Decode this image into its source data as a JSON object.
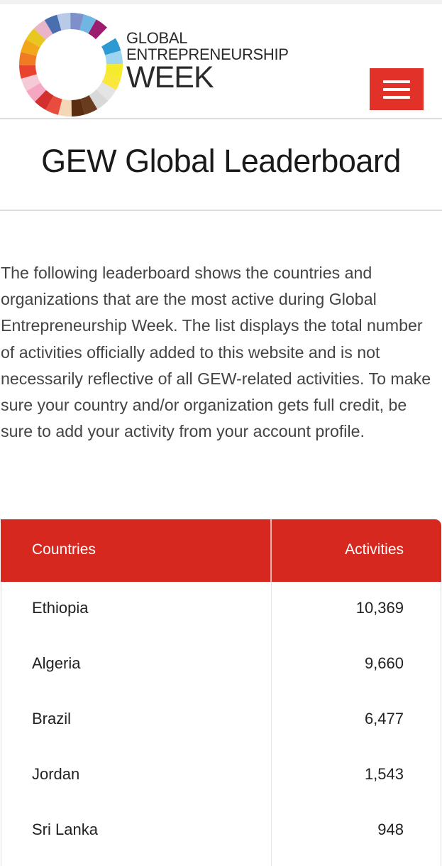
{
  "header": {
    "logo_line1": "GLOBAL",
    "logo_line2": "ENTREPRENEURSHIP",
    "logo_line3": "WEEK",
    "menu_icon": "hamburger-icon",
    "menu_color": "#e23128",
    "logo_ring_colors": [
      "#6fb7e2",
      "#9b1f6e",
      "#ffffff",
      "#2e9ad3",
      "#9ed4ef",
      "#f4ec2a",
      "#f9e83b",
      "#e4e4e4",
      "#d8d8d8",
      "#6b3b1f",
      "#5a2d12",
      "#f5d7b8",
      "#e74c3c",
      "#d32f2f",
      "#f4a6c3",
      "#f6c9d7",
      "#e8432f",
      "#ef7b22",
      "#f2a71b",
      "#e8c71e",
      "#eab5c8",
      "#4a6fb0",
      "#b9c9e8",
      "#7e8fc9"
    ]
  },
  "page": {
    "title": "GEW Global Leaderboard",
    "intro": "The following leaderboard shows the countries and organizations that are the most active during Global Entrepreneurship Week. The list displays the total number of activities officially added to this website and is not necessarily reflective of all GEW-related activities. To make sure your country and/or organization gets full credit, be sure to add your activity from your account profile."
  },
  "leaderboard": {
    "header_color": "#d6281e",
    "columns": {
      "countries": "Countries",
      "activities": "Activities"
    },
    "rows": [
      {
        "country": "Ethiopia",
        "activities": "10,369"
      },
      {
        "country": "Algeria",
        "activities": "9,660"
      },
      {
        "country": "Brazil",
        "activities": "6,477"
      },
      {
        "country": "Jordan",
        "activities": "1,543"
      },
      {
        "country": "Sri Lanka",
        "activities": "948"
      }
    ]
  }
}
